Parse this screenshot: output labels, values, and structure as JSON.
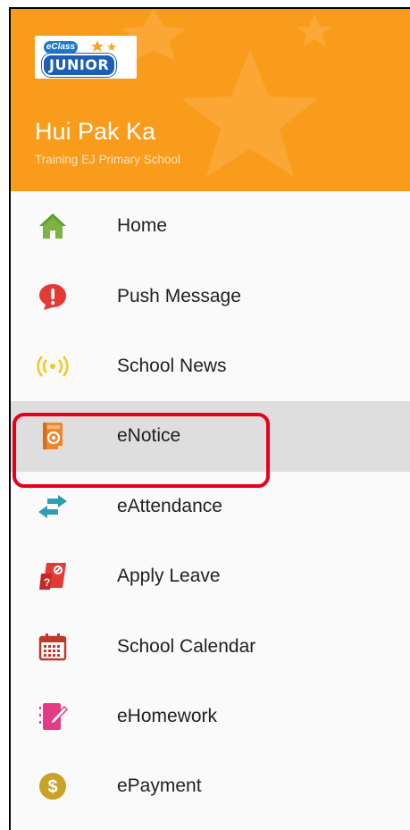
{
  "header": {
    "logo": {
      "top": "eClass",
      "main": "JUNIOR"
    },
    "user_name": "Hui Pak Ka",
    "school_name": "Training EJ Primary School",
    "background_color": "#f99c1c"
  },
  "menu": {
    "selected": "eNotice",
    "items": [
      {
        "label": "Home",
        "icon": "home-icon",
        "color": "#7cb342"
      },
      {
        "label": "Push Message",
        "icon": "exclamation-bubble-icon",
        "color": "#e53935"
      },
      {
        "label": "School News",
        "icon": "broadcast-icon",
        "color": "#f3c623"
      },
      {
        "label": "eNotice",
        "icon": "notice-book-icon",
        "color": "#f0852d"
      },
      {
        "label": "eAttendance",
        "icon": "swap-arrows-icon",
        "color": "#2f9db4"
      },
      {
        "label": "Apply Leave",
        "icon": "leave-card-icon",
        "color": "#e53935"
      },
      {
        "label": "School Calendar",
        "icon": "calendar-icon",
        "color": "#c0392b"
      },
      {
        "label": "eHomework",
        "icon": "homework-notebook-icon",
        "color": "#e33b86"
      },
      {
        "label": "ePayment",
        "icon": "dollar-coin-icon",
        "color": "#c9a227"
      }
    ]
  }
}
